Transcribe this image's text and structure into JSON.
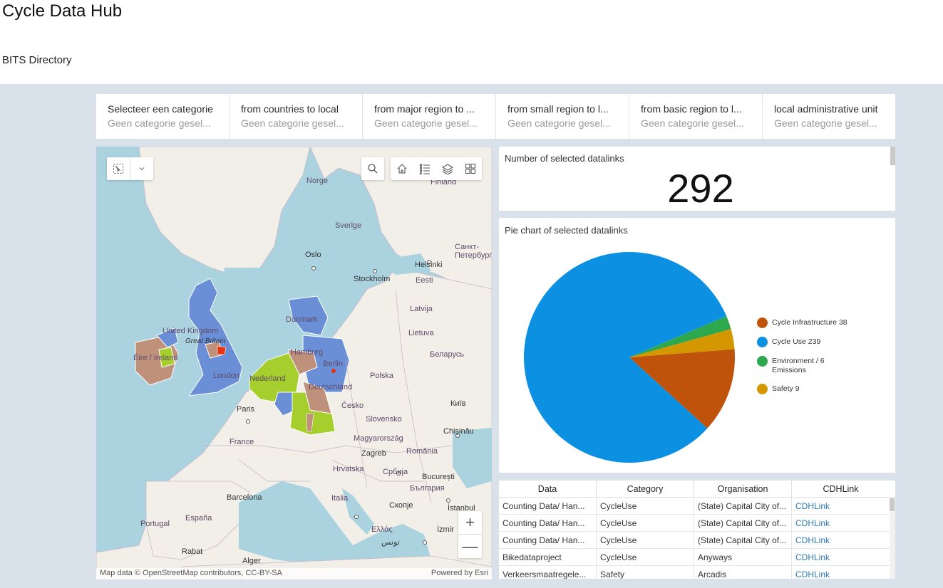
{
  "header": {
    "title": "Cycle Data Hub",
    "subtitle": "BITS Directory"
  },
  "selectors": [
    {
      "label": "Selecteer een categorie",
      "value": "Geen categorie gesel..."
    },
    {
      "label": "from countries to local",
      "value": "Geen categorie gesel..."
    },
    {
      "label": "from major region to ...",
      "value": "Geen categorie gesel..."
    },
    {
      "label": "from small region to l...",
      "value": "Geen categorie gesel..."
    },
    {
      "label": "from basic region to l...",
      "value": "Geen categorie gesel..."
    },
    {
      "label": "local administrative unit",
      "value": "Geen categorie gesel..."
    }
  ],
  "map": {
    "labels": {
      "norge": "Norge",
      "finland": "Finland",
      "sverige": "Sverige",
      "oslo": "Oslo",
      "helsinki": "Helsinki",
      "spb": "Санкт-Петербург",
      "stockholm": "Stockholm",
      "eesti": "Eesti",
      "latvija": "Latvija",
      "danmark": "Danmark",
      "lietuva": "Lietuva",
      "uk": "United Kingdom",
      "gb": "Great Britain",
      "eire": "Éire / Ireland",
      "london": "London",
      "hamburg": "Hamburg",
      "berlin": "Berlin",
      "belarus": "Беларусь",
      "polska": "Polska",
      "nederland": "Nederland",
      "deutschland": "Deutschland",
      "paris": "Paris",
      "cesko": "Česko",
      "kyiv": "Київ",
      "slovensko": "Slovensko",
      "france": "France",
      "magyar": "Magyarország",
      "chisinau": "Chișinău",
      "zagreb": "Zagreb",
      "romania": "România",
      "hrvatska": "Hrvatska",
      "srbija": "Србија",
      "bucuresti": "București",
      "barcelona": "Barcelona",
      "italia": "Italia",
      "bulgaria": "България",
      "skopje": "Скопје",
      "portugal": "Portugal",
      "espana": "España",
      "ellas": "Ελλάς",
      "izmir": "İzmir",
      "rabat": "Rabat",
      "alger": "Alger",
      "tunis": "تونس",
      "istanbul": "İstanbul"
    },
    "attribution_left": "Map data © OpenStreetMap contributors, CC-BY-SA",
    "attribution_right": "Powered by Esri",
    "zoom_in": "+",
    "zoom_out": "—",
    "region_colors": {
      "blue": "#6a8fd6",
      "brown": "#c0917a",
      "green": "#a6cf2e",
      "red": "#e8340c"
    }
  },
  "count_panel": {
    "title": "Number of selected datalinks",
    "value": "292"
  },
  "chart_data": {
    "type": "pie",
    "title": "Pie chart of selected datalinks",
    "legend_position": "right",
    "slices": [
      {
        "label": "Cycle Infrastructure",
        "value": 38,
        "color": "#c0530c"
      },
      {
        "label": "Cycle Use",
        "value": 239,
        "color": "#0b90e2"
      },
      {
        "label": "Environment / Emissions",
        "value": 6,
        "color": "#2ea84d"
      },
      {
        "label": "Safety",
        "value": 9,
        "color": "#d49700"
      }
    ]
  },
  "legend": [
    {
      "text": "Cycle Infrastructure  38"
    },
    {
      "text": "Cycle Use  239"
    },
    {
      "text": "Environment /  6 Emissions"
    },
    {
      "text": "Safety  9"
    }
  ],
  "table": {
    "headers": [
      "Data",
      "Category",
      "Organisation",
      "CDHLink"
    ],
    "rows": [
      [
        "Counting Data/ Han...",
        "CycleUse",
        "(State) Capital City of...",
        "CDHLink"
      ],
      [
        "Counting Data/ Han...",
        "CycleUse",
        "(State) Capital City of...",
        "CDHLink"
      ],
      [
        "Counting Data/ Han...",
        "CycleUse",
        "(State) Capital City of...",
        "CDHLink"
      ],
      [
        "Bikedataproject",
        "CycleUse",
        "Anyways",
        "CDHLink"
      ],
      [
        "Verkeersmaatregele...",
        "Safety",
        "Arcadis",
        "CDHLink"
      ]
    ]
  }
}
